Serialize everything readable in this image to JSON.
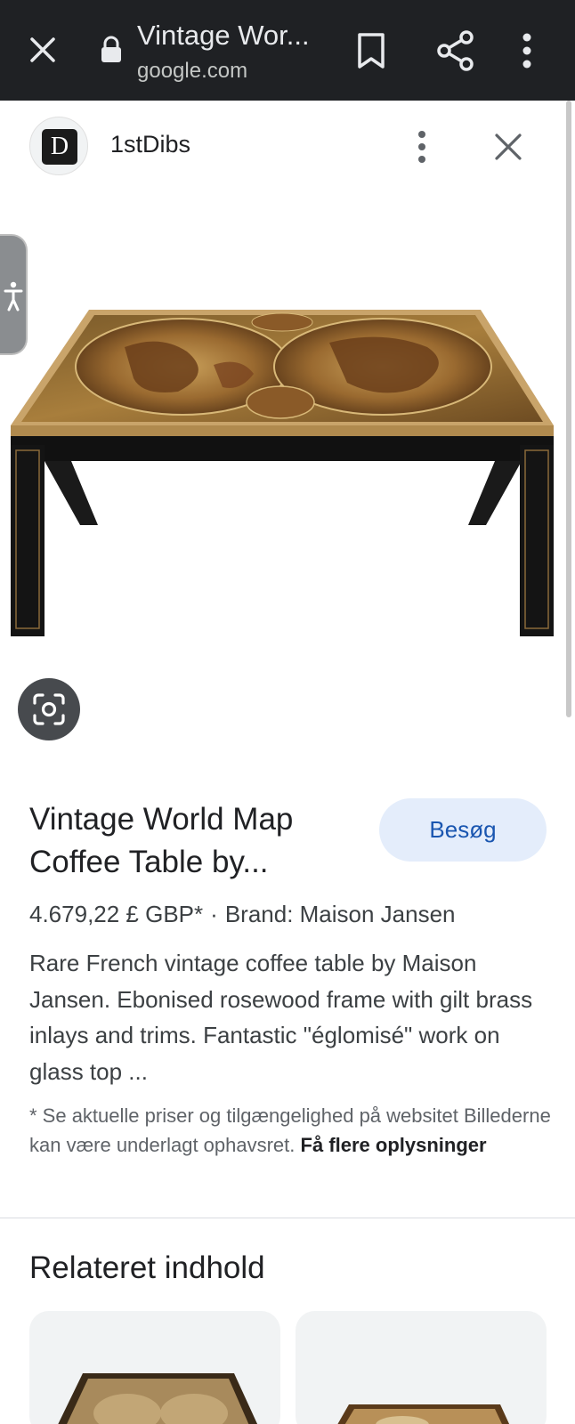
{
  "browser": {
    "title": "Vintage Wor...",
    "url": "google.com"
  },
  "source": {
    "logo_text": "D",
    "name": "1stDibs"
  },
  "product": {
    "title": "Vintage World Map Coffee Table by...",
    "visit_label": "Besøg",
    "price": "4.679,22 £ GBP*",
    "separator": "·",
    "brand": "Brand: Maison Jansen",
    "description": "Rare French vintage coffee table by Maison Jansen. Ebonised rosewood frame with gilt brass inlays and trims. Fantastic \"églomisé\" work on glass top ...",
    "note_text": "* Se aktuelle priser og tilgængelighed på websitet Billederne kan være underlagt ophavsret.",
    "note_link": "Få flere oplysninger"
  },
  "related": {
    "title": "Relateret indhold"
  },
  "icons": {
    "close": "close-icon",
    "lock": "lock-icon",
    "bookmark": "bookmark-icon",
    "share": "share-icon",
    "more": "more-vert-icon",
    "accessibility": "accessibility-icon",
    "lens": "lens-icon"
  },
  "colors": {
    "topbar": "#1f2124",
    "visit_button_bg": "#e4edfb",
    "visit_button_text": "#1a56b0"
  }
}
